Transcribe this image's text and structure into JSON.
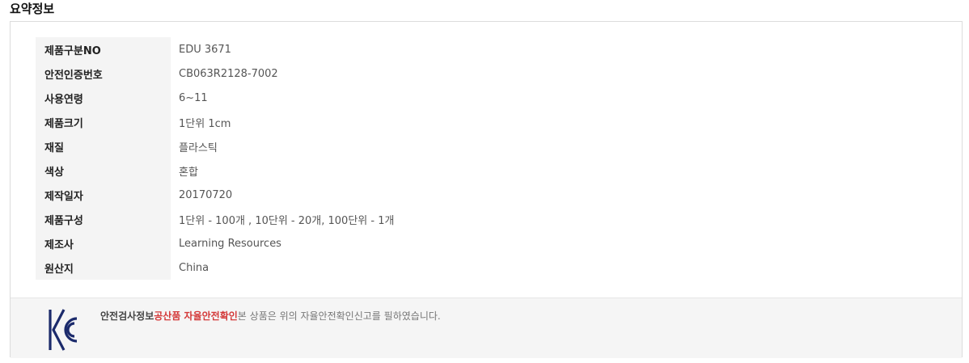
{
  "section": {
    "title": "요약정보"
  },
  "specs": [
    {
      "label": "제품구분NO",
      "value": "EDU 3671"
    },
    {
      "label": "안전인증번호",
      "value": "CB063R2128-7002"
    },
    {
      "label": "사용연령",
      "value": "6~11"
    },
    {
      "label": "제품크기",
      "value": "1단위 1cm"
    },
    {
      "label": "재질",
      "value": "플라스틱"
    },
    {
      "label": "색상",
      "value": "혼합"
    },
    {
      "label": "제작일자",
      "value": "20170720"
    },
    {
      "label": "제품구성",
      "value": "1단위 - 100개 , 10단위 - 20개, 100단위 - 1개"
    },
    {
      "label": "제조사",
      "value": "Learning Resources"
    },
    {
      "label": "원산지",
      "value": "China"
    }
  ],
  "certification": {
    "icon": "kc-mark-icon",
    "label": "안전검사정보",
    "highlight": "공산품 자율안전확인",
    "text": "본 상품은 위의 자율안전확인신고를 필하였습니다.",
    "highlight_color": "#d43a3a"
  }
}
